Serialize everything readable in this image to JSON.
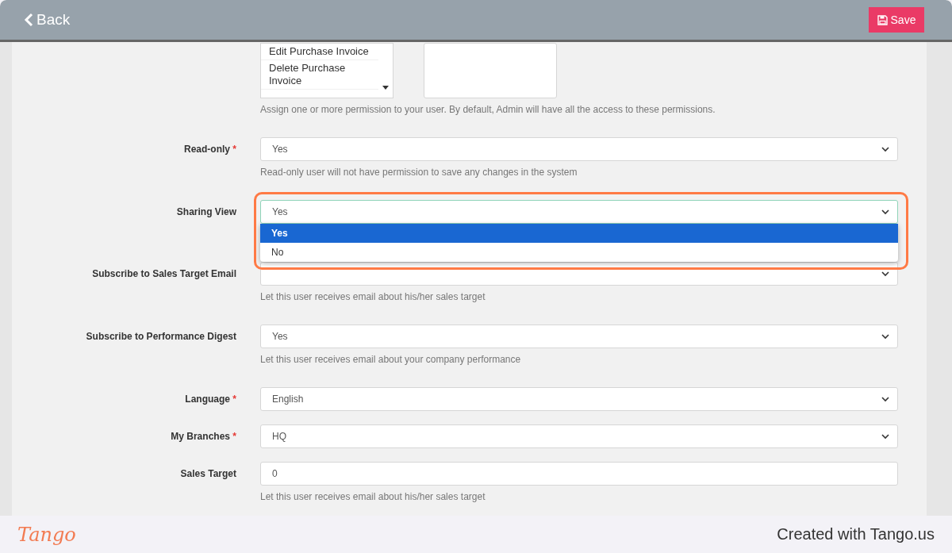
{
  "header": {
    "back_label": "Back",
    "save_label": "Save"
  },
  "form": [
    {
      "kind": "listbox",
      "options": [
        "Edit Purchase Invoice",
        "Delete Purchase Invoice"
      ],
      "help": "Assign one or more permission to your user. By default, Admin will have all the access to these permissions."
    },
    {
      "kind": "select",
      "label": "Read-only",
      "required_mark": "*",
      "value": "Yes",
      "help": "Read-only user will not have permission to save any changes in the system"
    },
    {
      "kind": "select",
      "label": "Sharing View",
      "value": "Yes",
      "open": true,
      "options": [
        {
          "label": "Yes",
          "selected": true
        },
        {
          "label": "No",
          "selected": false
        }
      ]
    },
    {
      "kind": "select",
      "label": "Subscribe to Sales Target Email",
      "help": "Let this user receives email about his/her sales target"
    },
    {
      "kind": "select",
      "label": "Subscribe to Performance Digest",
      "value": "Yes",
      "help": "Let this user receives email about your company performance"
    },
    {
      "kind": "select",
      "label": "Language",
      "required_mark": "*",
      "value": "English"
    },
    {
      "kind": "select",
      "label": "My Branches",
      "required_mark": "*",
      "value": "HQ"
    },
    {
      "kind": "input",
      "label": "Sales Target",
      "value": "0",
      "help": "Let this user receives email about his/her sales target"
    }
  ],
  "footer": {
    "logo": "Tango",
    "credit": "Created with Tango.us"
  }
}
